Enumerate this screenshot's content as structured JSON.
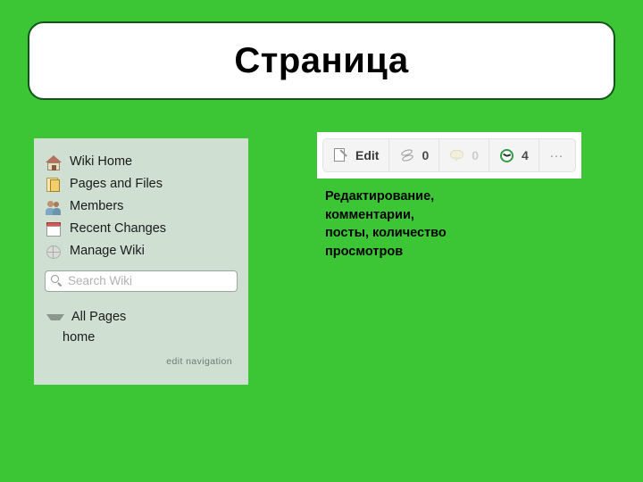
{
  "page": {
    "background_color": "#3cc636",
    "title": "Страница"
  },
  "title_banner": {
    "text": "Страница",
    "border_color": "#14521a",
    "background_color": "#ffffff"
  },
  "sidebar": {
    "background_color": "#cfe0d3",
    "items": [
      {
        "label": "Wiki Home",
        "icon": "house-icon"
      },
      {
        "label": "Pages and Files",
        "icon": "pages-icon"
      },
      {
        "label": "Members",
        "icon": "members-icon"
      },
      {
        "label": "Recent Changes",
        "icon": "calendar-icon"
      },
      {
        "label": "Manage Wiki",
        "icon": "gear-icon"
      }
    ],
    "search": {
      "placeholder": "Search Wiki",
      "value": "",
      "icon": "search-icon"
    },
    "tree": {
      "root_label": "All Pages",
      "caret_icon": "chevron-down-icon",
      "children": [
        "home"
      ]
    },
    "edit_navigation_label": "edit navigation"
  },
  "toolbar": {
    "buttons": [
      {
        "label": "Edit",
        "icon": "edit-page-icon",
        "count": null,
        "dim": false
      },
      {
        "label": "",
        "icon": "posts-icon",
        "count": "0",
        "dim": false
      },
      {
        "label": "",
        "icon": "comment-icon",
        "count": "0",
        "dim": true
      },
      {
        "label": "",
        "icon": "clock-icon",
        "count": "4",
        "dim": false
      },
      {
        "label": "…",
        "icon": "overflow-icon",
        "count": null,
        "dim": false
      }
    ],
    "overflow_label": "…"
  },
  "caption": {
    "text": "Редактирование,\nкомментарии,\n посты, количество\nпросмотров"
  }
}
